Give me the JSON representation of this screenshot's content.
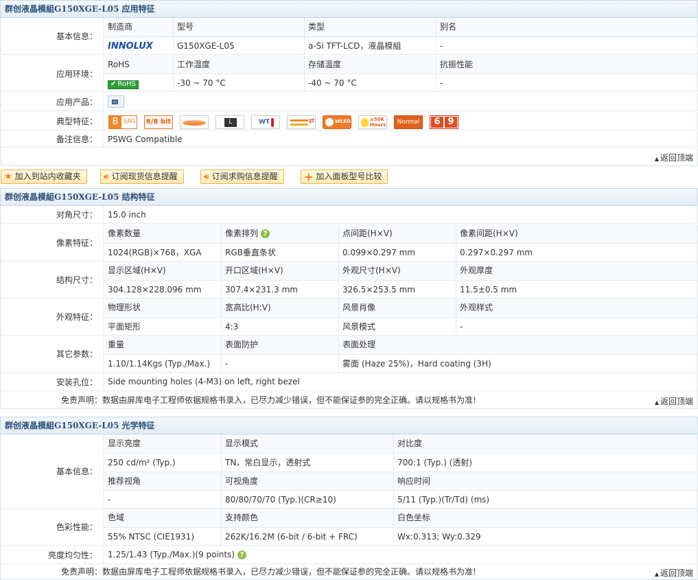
{
  "sec1": {
    "title": "群创液晶模組G150XGE-L05 应用特征",
    "basic_label": "基本信息：",
    "basic_heads": [
      "制造商",
      "型号",
      "类型",
      "别名"
    ],
    "basic_vals": [
      "",
      "G150XGE-L05",
      "a-Si TFT-LCD，液晶模組",
      "-"
    ],
    "brand_logo": "INNOLUX",
    "env_label": "应用环境：",
    "env_heads": [
      "RoHS",
      "工作温度",
      "存储温度",
      "抗振性能"
    ],
    "env_vals": [
      "RoHS",
      "-30 ~ 70 °C",
      "-40 ~ 70 °C",
      "-"
    ],
    "product_label": "应用产品：",
    "feature_label": "典型特征：",
    "feature_icons": [
      "B",
      "SAG",
      "6/8 bit",
      "",
      "L",
      "WT",
      "",
      "WLED",
      "≥50K Hours",
      "Normal",
      "6",
      "9"
    ],
    "remark_label": "备注信息：",
    "remark_value": "PSWG Compatible",
    "back_top": "返回顶端"
  },
  "actions": {
    "fav": "加入到站内收藏夹",
    "stock": "订阅现货信息提醒",
    "buy": "订阅求购信息提醒",
    "compare": "加入面板型号比较"
  },
  "sec2": {
    "title": "群创液晶模組G150XGE-L05 结构特征",
    "diag_label": "对角尺寸：",
    "diag_value": "15.0 inch",
    "pixel_label": "像素特征：",
    "pixel_heads": [
      "像素数量",
      "像素排列",
      "点间距(H×V)",
      "像素间距(H×V)"
    ],
    "pixel_vals": [
      "1024(RGB)×768，XGA",
      "RGB垂直条状",
      "0.099×0.297 mm",
      "0.297×0.297 mm"
    ],
    "struct_label": "结构尺寸：",
    "struct_heads": [
      "显示区域(H×V)",
      "开口区域(H×V)",
      "外观尺寸(H×V)",
      "外观厚度"
    ],
    "struct_vals": [
      "304.128×228.096 mm",
      "307.4×231.3 mm",
      "326.5×253.5 mm",
      "11.5±0.5 mm"
    ],
    "look_label": "外观特征：",
    "look_heads": [
      "物理形状",
      "宽高比(H:V)",
      "风景肖像",
      "外观样式"
    ],
    "look_vals": [
      "平面矩形",
      "4:3",
      "风景模式",
      "-"
    ],
    "other_label": "其它参数：",
    "other_heads": [
      "重量",
      "表面防护",
      "表面处理"
    ],
    "other_vals": [
      "1.10/1.14Kgs (Typ./Max.)",
      "-",
      "雾面 (Haze 25%)，Hard coating (3H)"
    ],
    "mount_label": "安装孔位：",
    "mount_value": "Side mounting holes (4-M3) on left, right bezel",
    "disclaimer": "免责声明：数据由屏库电子工程师依据规格书录入，已尽力减少错误，但不能保证参的完全正确。请以规格书为准!",
    "back_top": "返回顶端"
  },
  "sec3": {
    "title": "群创液晶模組G150XGE-L05 光学特征",
    "basic_label": "基本信息：",
    "b_heads1": [
      "显示亮度",
      "显示模式",
      "对比度"
    ],
    "b_vals1": [
      "250 cd/m² (Typ.)",
      "TN，常白显示，透射式",
      "700:1 (Typ.) (透射)"
    ],
    "b_heads2": [
      "推荐视角",
      "可视角度",
      "响应时间"
    ],
    "b_vals2": [
      "-",
      "80/80/70/70 (Typ.)(CR≥10)",
      "5/11 (Typ.)(Tr/Td) (ms)"
    ],
    "color_label": "色彩性能：",
    "color_heads": [
      "色域",
      "支持颜色",
      "白色坐标"
    ],
    "color_vals": [
      "55% NTSC (CIE1931)",
      "262K/16.2M (6-bit / 6-bit + FRC)",
      "Wx:0.313; Wy:0.329"
    ],
    "uni_label": "亮度均匀性：",
    "uni_value": "1.25/1.43 (Typ./Max.)(9 points)",
    "disclaimer": "免责声明：数据由屏库电子工程师依据规格书录入，已尽力减少错误，但不能保证参的完全正确。请以规格书为准!",
    "back_top": "返回顶端"
  },
  "colors": {
    "header_text": "#2a4f7a",
    "border": "#d3e0ec",
    "accent_green": "#2e9e38",
    "btn_border": "#e8b54a"
  }
}
